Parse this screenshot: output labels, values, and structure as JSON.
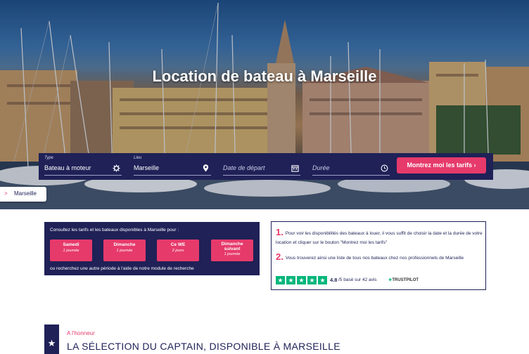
{
  "hero": {
    "title": "Location de bateau à Marseille"
  },
  "search": {
    "type": {
      "label": "Type",
      "value": "Bateau à moteur",
      "icon": "gear-icon"
    },
    "location": {
      "label": "Lieu",
      "value": "Marseille",
      "icon": "location-pin-icon"
    },
    "start_date": {
      "placeholder": "Date de départ",
      "icon": "calendar-icon"
    },
    "duration": {
      "placeholder": "Durée",
      "icon": "clock-icon"
    },
    "submit_label": "Montrez moi les tarifs ›"
  },
  "breadcrumb": {
    "arrow": ">",
    "label": "Marseille"
  },
  "dates": {
    "intro": "Consultez les tarifs et les bateaux disponibles à Marseille pour :",
    "buttons": [
      {
        "title": "Samedi",
        "sub": "1 journée"
      },
      {
        "title": "Dimanche",
        "sub": "1 journée"
      },
      {
        "title": "Ce WE",
        "sub": "2 jours"
      },
      {
        "title_line1": "Dimanche",
        "title_line2": "suivant",
        "sub": "1 journée"
      }
    ],
    "outro": "ou recherchez une autre période à l'aide de notre module de recherche"
  },
  "info": {
    "step1_num": "1.",
    "step1_text": "Pour voir les disponibilités des bateaux à louer, il vous suffit de choisir la date et la durée de votre location et cliquer sur le bouton \"Montrez moi les tarifs\"",
    "step2_num": "2.",
    "step2_text": "Vous trouverez ainsi une liste de tous nos bateaux chez nos professionnels de Marseille"
  },
  "trustpilot": {
    "star_count": 5,
    "score": "4.8",
    "rest": "/5 basé sur 42 avis",
    "brand": "TRUSTPILOT",
    "color": "#00b67a"
  },
  "selection": {
    "flag_icon": "star-icon",
    "eyebrow": "A l'honneur",
    "title": "LA SÉLECTION DU CAPTAIN, DISPONIBLE À MARSEILLE"
  },
  "colors": {
    "navy": "#1f2157",
    "pink": "#e63a6b"
  }
}
